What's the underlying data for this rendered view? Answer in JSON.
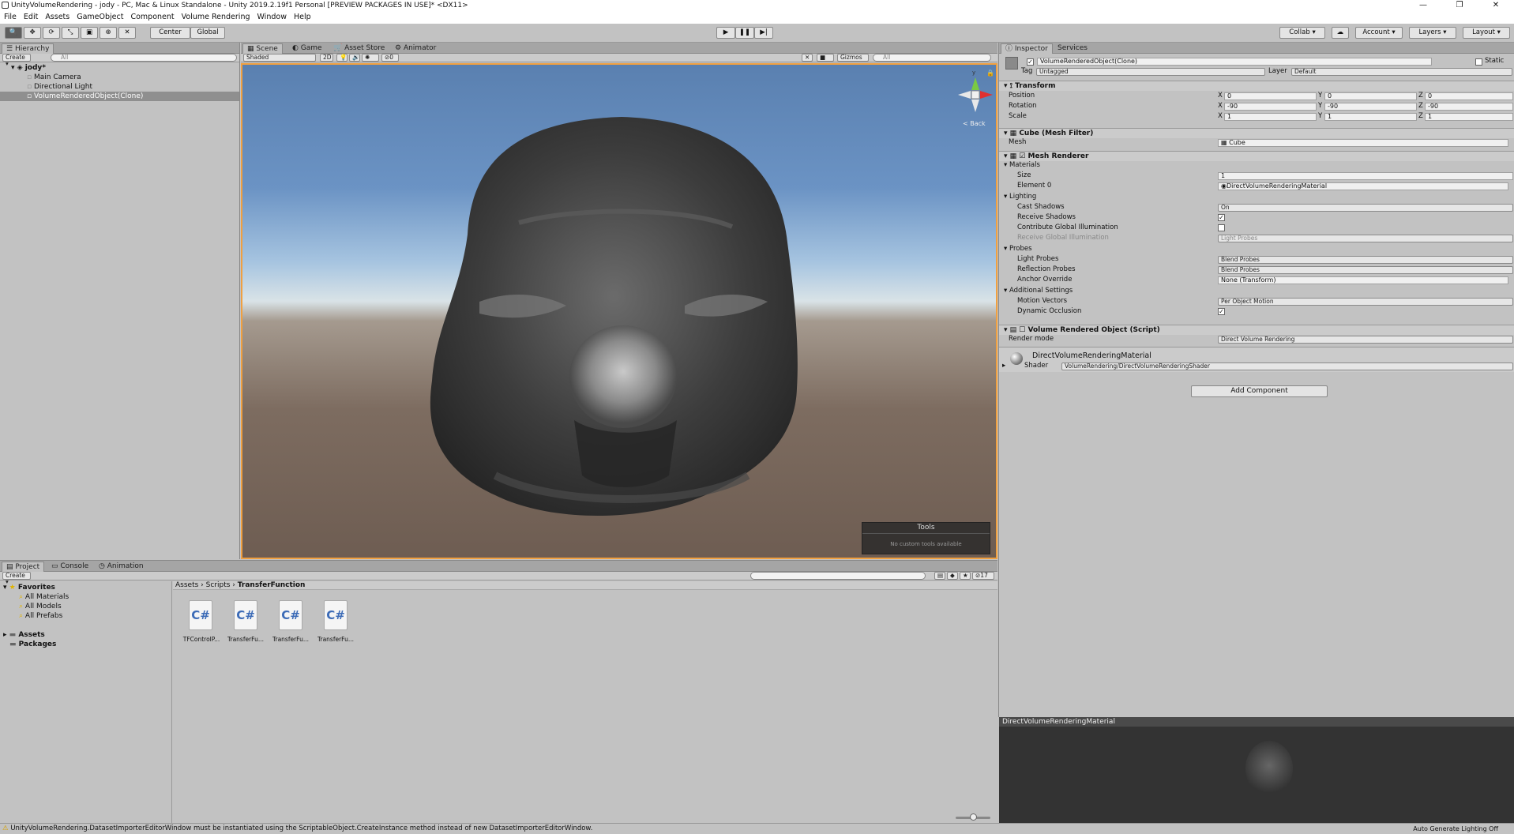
{
  "window": {
    "title": "UnityVolumeRendering - jody - PC, Mac & Linux Standalone - Unity 2019.2.19f1 Personal [PREVIEW PACKAGES IN USE]* <DX11>",
    "minimize": "—",
    "maximize": "❐",
    "close": "✕"
  },
  "menu": [
    "File",
    "Edit",
    "Assets",
    "GameObject",
    "Component",
    "Volume Rendering",
    "Window",
    "Help"
  ],
  "toolbar": {
    "pivot": "Center",
    "space": "Global",
    "collab": "Collab",
    "account": "Account",
    "layers": "Layers",
    "layout": "Layout"
  },
  "hierarchy": {
    "tab": "Hierarchy",
    "create": "Create",
    "search_placeholder": "All",
    "scene": "jody*",
    "items": [
      "Main Camera",
      "Directional Light",
      "VolumeRenderedObject(Clone)"
    ]
  },
  "scene": {
    "tabs": [
      "Scene",
      "Game",
      "Asset Store",
      "Animator"
    ],
    "shading": "Shaded",
    "mode2d": "2D",
    "gizmos": "Gizmos",
    "search_placeholder": "All",
    "hidden_count": "0",
    "back": "< Back",
    "gizmo_y": "y",
    "tools_title": "Tools",
    "tools_empty": "No custom tools available"
  },
  "inspector": {
    "tabs": [
      "Inspector",
      "Services"
    ],
    "object_name": "VolumeRenderedObject(Clone)",
    "static": "Static",
    "tag_label": "Tag",
    "tag_value": "Untagged",
    "layer_label": "Layer",
    "layer_value": "Default",
    "transform": {
      "title": "Transform",
      "position_label": "Position",
      "rotation_label": "Rotation",
      "scale_label": "Scale",
      "position": [
        "0",
        "0",
        "0"
      ],
      "rotation": [
        "-90",
        "-90",
        "-90"
      ],
      "scale": [
        "1",
        "1",
        "1"
      ]
    },
    "mesh_filter": {
      "title": "Cube (Mesh Filter)",
      "mesh_label": "Mesh",
      "mesh_value": "Cube"
    },
    "mesh_renderer": {
      "title": "Mesh Renderer",
      "materials": "Materials",
      "size_label": "Size",
      "size_value": "1",
      "element0_label": "Element 0",
      "element0_value": "DirectVolumeRenderingMaterial",
      "lighting": "Lighting",
      "cast_shadows_label": "Cast Shadows",
      "cast_shadows_value": "On",
      "receive_shadows_label": "Receive Shadows",
      "contribute_gi_label": "Contribute Global Illumination",
      "receive_gi_label": "Receive Global Illumination",
      "receive_gi_value": "Light Probes",
      "probes": "Probes",
      "light_probes_label": "Light Probes",
      "light_probes_value": "Blend Probes",
      "reflection_probes_label": "Reflection Probes",
      "reflection_probes_value": "Blend Probes",
      "anchor_override_label": "Anchor Override",
      "anchor_override_value": "None (Transform)",
      "additional": "Additional Settings",
      "motion_vectors_label": "Motion Vectors",
      "motion_vectors_value": "Per Object Motion",
      "dynamic_occlusion_label": "Dynamic Occlusion"
    },
    "script": {
      "title": "Volume Rendered Object (Script)",
      "render_mode_label": "Render mode",
      "render_mode_value": "Direct Volume Rendering"
    },
    "material": {
      "name": "DirectVolumeRenderingMaterial",
      "shader_label": "Shader",
      "shader_value": "VolumeRendering/DirectVolumeRenderingShader"
    },
    "add_component": "Add Component",
    "preview_title": "DirectVolumeRenderingMaterial"
  },
  "project": {
    "tabs": [
      "Project",
      "Console",
      "Animation"
    ],
    "create": "Create",
    "count": "17",
    "favorites": "Favorites",
    "fav_items": [
      "All Materials",
      "All Models",
      "All Prefabs"
    ],
    "assets": "Assets",
    "packages": "Packages",
    "breadcrumb": [
      "Assets",
      "Scripts",
      "TransferFunction"
    ],
    "files": [
      "TFControlP...",
      "TransferFu...",
      "TransferFu...",
      "TransferFu..."
    ],
    "file_glyph": "C#"
  },
  "status": {
    "message": "UnityVolumeRendering.DatasetImporterEditorWindow must be instantiated using the ScriptableObject.CreateInstance method instead of new DatasetImporterEditorWindow.",
    "right": "Auto Generate Lighting Off"
  },
  "colors": {
    "accent": "#3d6cb7",
    "sky_top": "#5a80b0",
    "ground": "#6e5d52"
  }
}
